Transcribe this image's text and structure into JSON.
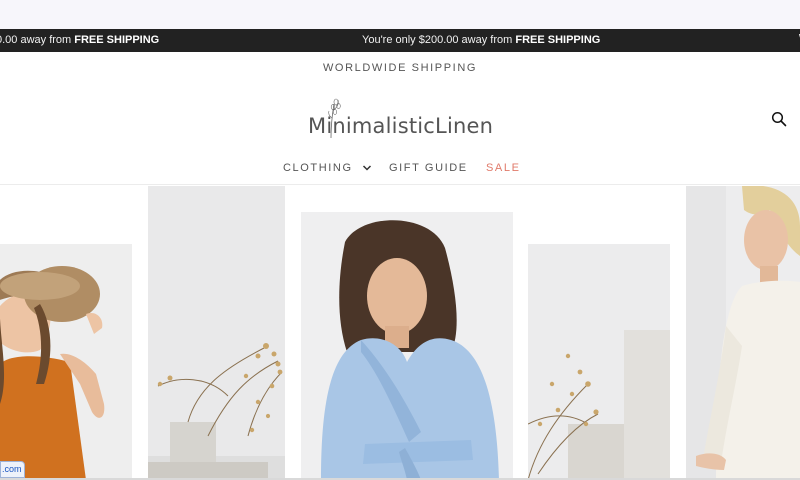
{
  "announcement": {
    "left_prefix": "0.00 away from ",
    "left_bold": "FREE SHIPPING",
    "main_prefix": "You're only $200.00 away from ",
    "main_bold": "FREE SHIPPING",
    "edge_glyph": "\\"
  },
  "header": {
    "tagline": "WORLDWIDE SHIPPING",
    "logo_text": "MinimalisticLinen"
  },
  "nav": {
    "clothing": "CLOTHING",
    "gift_guide": "GIFT GUIDE",
    "sale": "SALE"
  },
  "status_badge": ".com",
  "colors": {
    "announcement_bg": "#222222",
    "sale": "#e07a6a",
    "dress_orange": "#d0711f",
    "wrap_blue": "#a9c6e6"
  },
  "icons": [
    "plant-logo-icon",
    "search-icon",
    "chevron-down-icon"
  ]
}
